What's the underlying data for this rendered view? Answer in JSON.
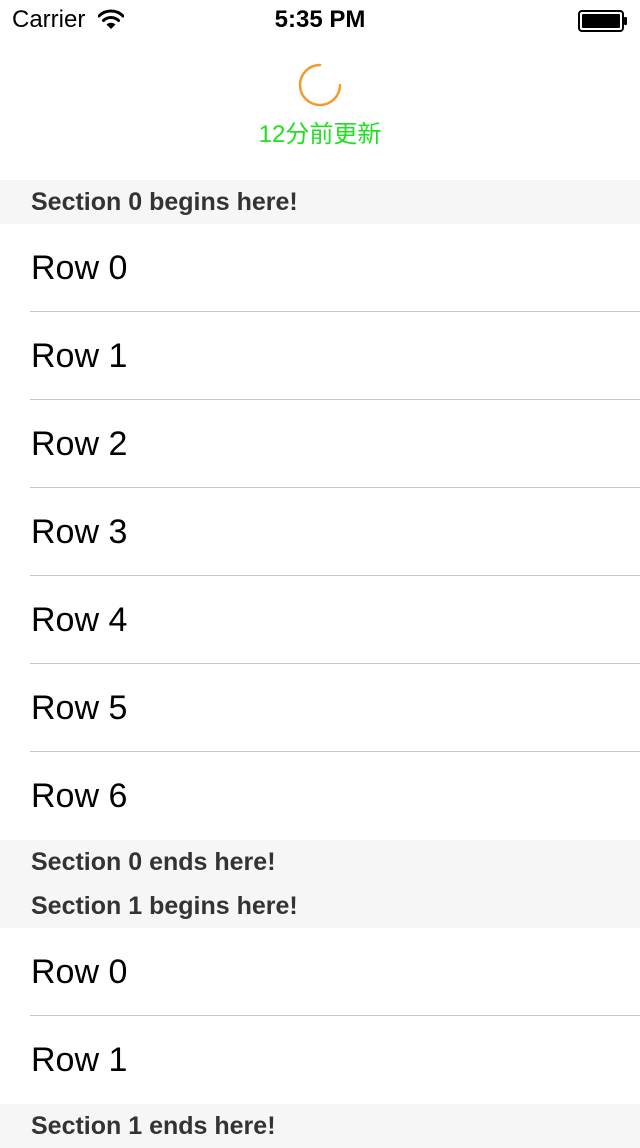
{
  "status_bar": {
    "carrier": "Carrier",
    "time": "5:35 PM",
    "wifi_icon": "wifi-icon",
    "battery_icon": "battery-icon"
  },
  "refresh": {
    "spinner_icon": "spinner-icon",
    "spinner_color": "#F39A2B",
    "text": "12分前更新",
    "text_color": "#21E021"
  },
  "sections": [
    {
      "header": "Section 0 begins here!",
      "rows": [
        "Row 0",
        "Row 1",
        "Row 2",
        "Row 3",
        "Row 4",
        "Row 5",
        "Row 6"
      ],
      "footer": "Section 0 ends here!"
    },
    {
      "header": "Section 1 begins here!",
      "rows": [
        "Row 0",
        "Row 1"
      ],
      "footer": "Section 1 ends here!"
    }
  ]
}
